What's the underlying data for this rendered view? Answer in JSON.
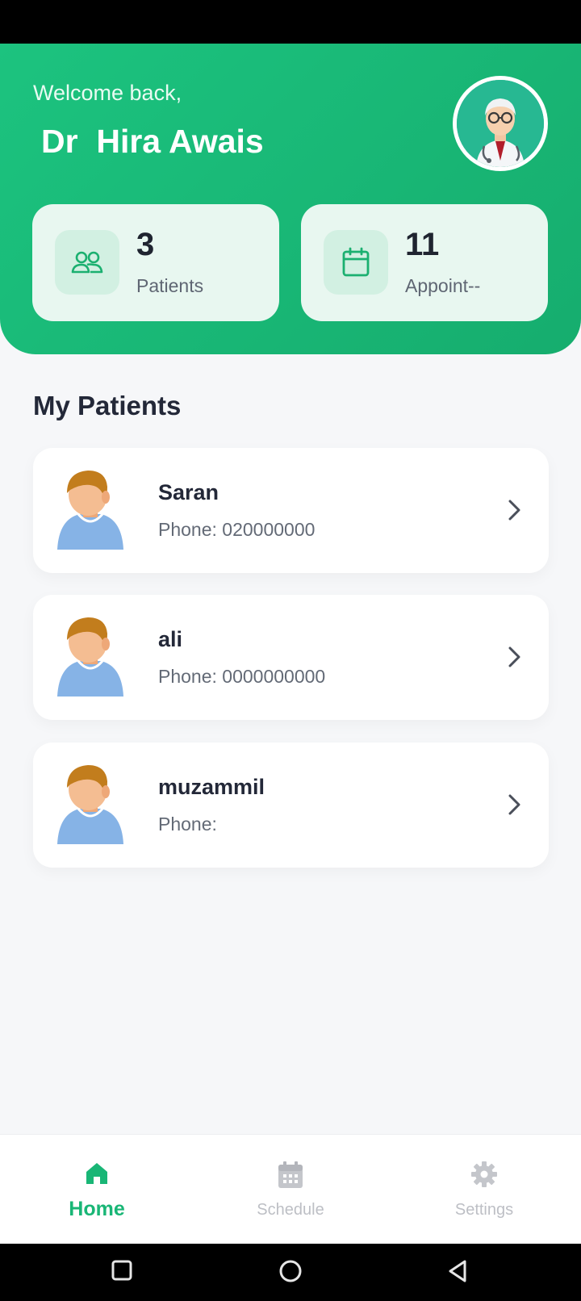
{
  "header": {
    "welcome": "Welcome back,",
    "doctor_name": "Dr  Hira Awais",
    "avatar_icon": "doctor-avatar-icon"
  },
  "stats": [
    {
      "value": "3",
      "label": "Patients",
      "icon": "users-icon"
    },
    {
      "value": "11",
      "label": "Appoint--",
      "icon": "calendar-icon"
    }
  ],
  "section_title": "My Patients",
  "patients": [
    {
      "name": "Saran",
      "phone": "Phone: 020000000"
    },
    {
      "name": "ali",
      "phone": "Phone: 0000000000"
    },
    {
      "name": "muzammil",
      "phone": "Phone: "
    }
  ],
  "nav": {
    "items": [
      {
        "label": "Home",
        "icon": "home-icon",
        "active": true
      },
      {
        "label": "Schedule",
        "icon": "calendar-icon",
        "active": false
      },
      {
        "label": "Settings",
        "icon": "gear-icon",
        "active": false
      }
    ]
  },
  "colors": {
    "brand_green": "#1cc37f",
    "text_dark": "#232838",
    "inactive_nav": "#bdbfc5"
  }
}
